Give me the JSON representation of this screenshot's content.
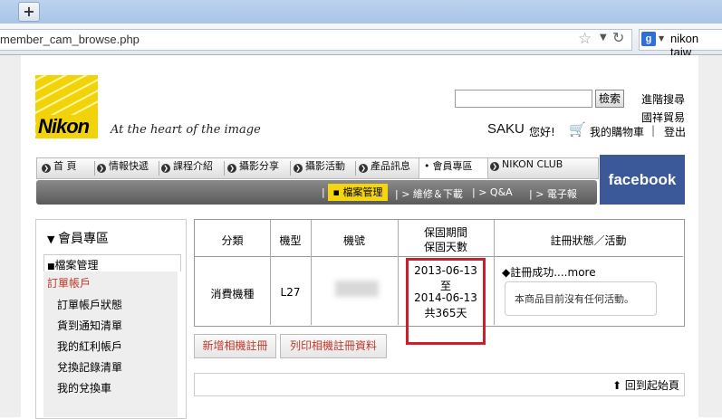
{
  "browser": {
    "new_tab_label": "+",
    "url": "member_cam_browse.php",
    "search_engine_icon": "g",
    "search_text": "nikon taiw"
  },
  "brand": {
    "logo_text": "Nikon",
    "tagline": "At the heart of the image",
    "logo_color": "#f2d30a",
    "facebook_label": "facebook",
    "facebook_color": "#3b5998"
  },
  "header": {
    "search_button": "檢索",
    "advanced_search": "進階搜尋",
    "trade": "國祥貿易",
    "username": "SAKU",
    "greeting": "您好!",
    "cart": "我的購物車",
    "separator": "|",
    "logout": "登出"
  },
  "nav": {
    "items": [
      "首 頁",
      "情報快遞",
      "課程介紹",
      "攝影分享",
      "攝影活動",
      "產品訊息",
      "會員專區",
      "NIKON CLUB"
    ],
    "active": "會員專區"
  },
  "subnav": {
    "active": "檔案管理",
    "items": [
      "維修＆下載",
      "Q&A",
      "電子報"
    ]
  },
  "sidebar": {
    "title": "會員專區",
    "file_mgmt": "檔案管理",
    "account": "訂單帳戶",
    "items": [
      "訂單帳戶狀態",
      "貨到通知清單",
      "我的紅利帳戶",
      "兌換記錄清單",
      "我的兌換車"
    ]
  },
  "table": {
    "headers": {
      "category": "分類",
      "model": "機型",
      "serial": "機號",
      "warranty_line1": "保固期間",
      "warranty_line2": "保固天數",
      "status": "註冊狀態／活動"
    },
    "row": {
      "category": "消費機種",
      "model": "L27",
      "warranty_start": "2013-06-13",
      "warranty_to": "至",
      "warranty_end": "2014-06-13",
      "warranty_days": "共365天",
      "status_text": "◆註冊成功....",
      "status_more": "more",
      "activity_note": "本商品目前沒有任何活動。"
    }
  },
  "actions": {
    "add_camera": "新增相機註冊",
    "print": "列印相機註冊資料",
    "back_to_top": "回到起始頁"
  },
  "highlight_color": "#cc1f2c"
}
